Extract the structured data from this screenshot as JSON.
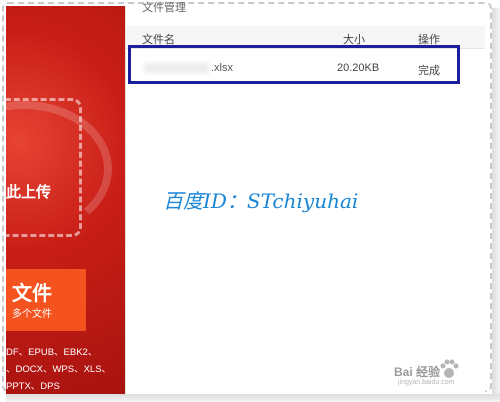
{
  "left_panel": {
    "upload_label": "此上传",
    "add_file_title": "文件",
    "add_file_subtitle": "多个文件",
    "formats_line1": "DF、EPUB、EBK2、",
    "formats_line2": "、DOCX、WPS、XLS、",
    "formats_line3": "PPTX、DPS"
  },
  "content": {
    "tab_title": "文件管理",
    "columns": {
      "name": "文件名",
      "size": "大小",
      "action": "操作"
    },
    "file_row": {
      "name_ext": ".xlsx",
      "size": "20.20KB",
      "status": "完成"
    }
  },
  "watermark": {
    "text": "百度ID：STchiyuhai",
    "baidu_logo": "Bai 经验",
    "baidu_sub": "jingyan.baidu.com"
  },
  "colors": {
    "brand_red": "#c81e17",
    "orange": "#f4521f",
    "highlight_blue": "#1c1f9c",
    "watermark_blue": "#1a86d6"
  }
}
